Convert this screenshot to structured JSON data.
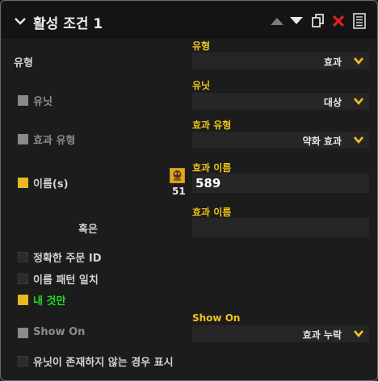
{
  "header": {
    "title": "활성 조건 1",
    "icons": [
      "collapse-chevron-icon",
      "move-up-icon",
      "move-down-icon",
      "copy-icon",
      "delete-icon",
      "list-icon"
    ]
  },
  "left": {
    "type_label": "유형",
    "unit_label": "유닛",
    "effect_type_label": "효과 유형",
    "name_label": "이름(s)",
    "name_count": "51",
    "or_label": "혹은",
    "exact_order_id": "정확한 주문 ID",
    "name_pattern": "이름 패턴 일치",
    "mine_only": "내 것만",
    "show_on": "Show On",
    "show_if_no_unit": "유닛이 존재하지 않는 경우 표시"
  },
  "right": {
    "type": {
      "label": "유형",
      "value": "효과"
    },
    "unit": {
      "label": "유닛",
      "value": "대상"
    },
    "effect_type": {
      "label": "효과 유형",
      "value": "약화 효과"
    },
    "effect_name": {
      "label": "효과 이름",
      "value": "589"
    },
    "effect_name2": {
      "label": "효과 이름",
      "value": ""
    },
    "show_on": {
      "label": "Show On",
      "value": "효과 누락"
    }
  },
  "colors": {
    "accent": "#f0c419",
    "delete": "#e02020",
    "green": "#22dd22",
    "background": "#1c1c1c"
  }
}
